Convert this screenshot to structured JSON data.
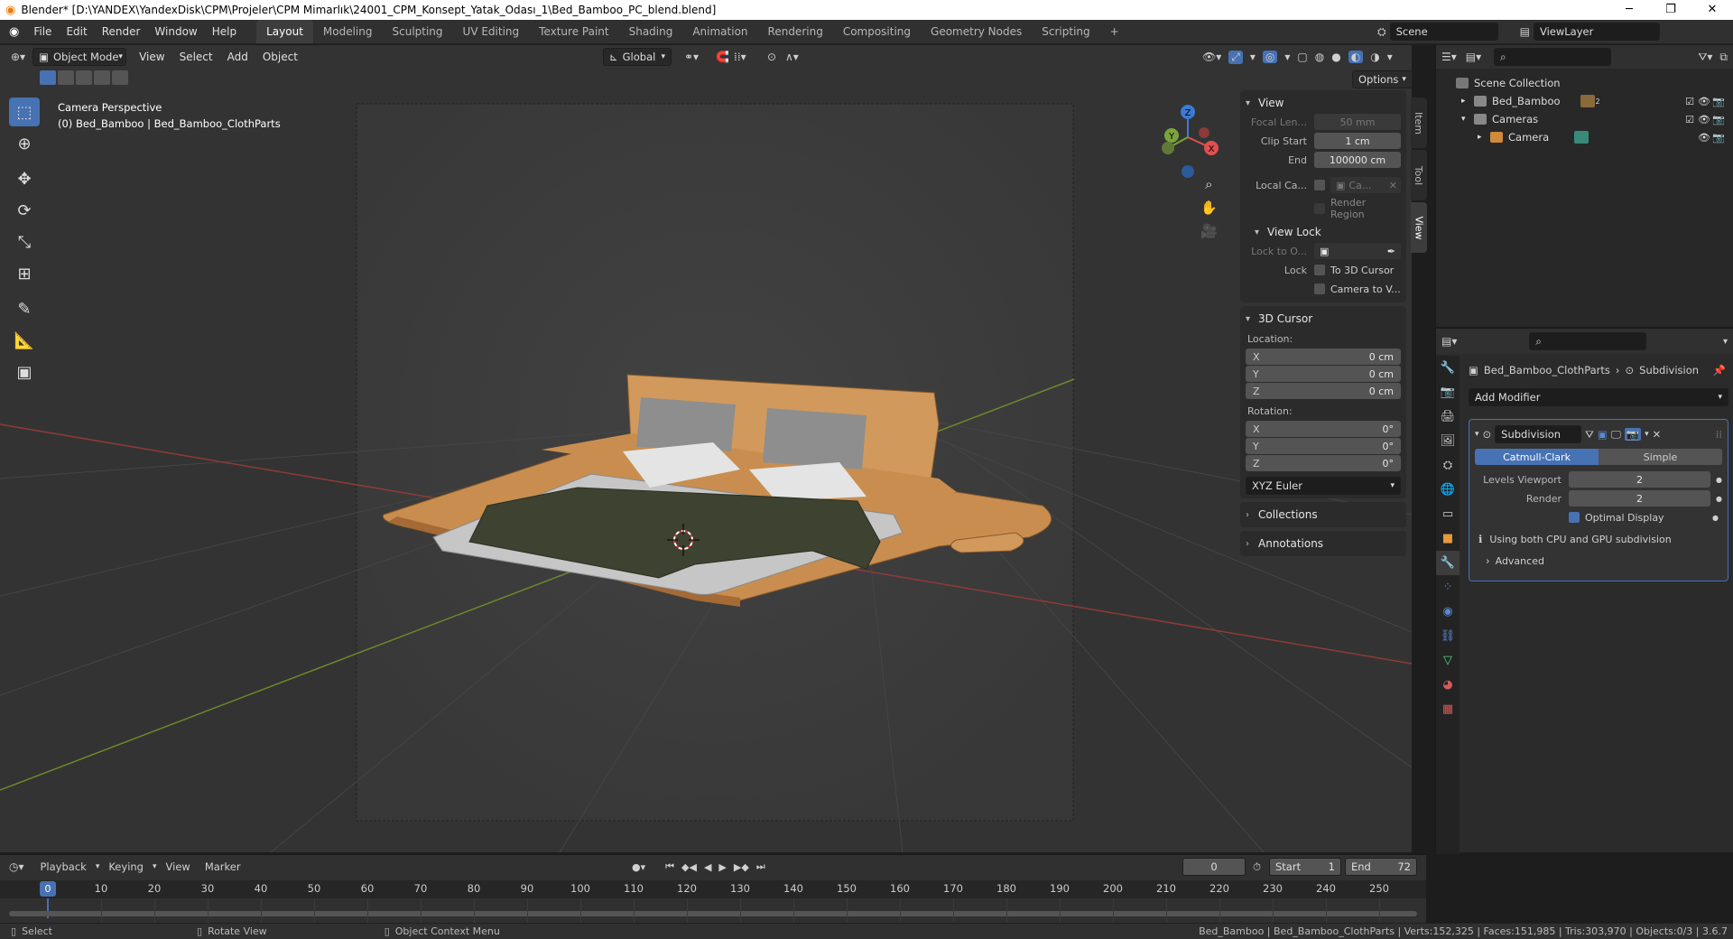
{
  "window": {
    "title": "Blender* [D:\\YANDEX\\YandexDisk\\CPM\\Projeler\\CPM Mimarlık\\24001_CPM_Konsept_Yatak_Odası_1\\Bed_Bamboo_PC_blend.blend]"
  },
  "menu": [
    "File",
    "Edit",
    "Render",
    "Window",
    "Help"
  ],
  "workspaces": [
    "Layout",
    "Modeling",
    "Sculpting",
    "UV Editing",
    "Texture Paint",
    "Shading",
    "Animation",
    "Rendering",
    "Compositing",
    "Geometry Nodes",
    "Scripting"
  ],
  "workspace_add": "+",
  "scene": {
    "name": "Scene",
    "view_layer": "ViewLayer"
  },
  "viewport": {
    "mode": "Object Mode",
    "menus": [
      "View",
      "Select",
      "Add",
      "Object"
    ],
    "orientation": "Global",
    "options": "Options",
    "overlay_title": "Camera Perspective",
    "overlay_subtitle": "(0) Bed_Bamboo | Bed_Bamboo_ClothParts"
  },
  "gizmo": {
    "z": "Z",
    "x": "X",
    "y": "Y"
  },
  "npanel": {
    "tabs": [
      "Item",
      "Tool",
      "View"
    ],
    "view": {
      "header": "View",
      "focal_label": "Focal Len...",
      "focal_value": "50 mm",
      "clip_start_label": "Clip Start",
      "clip_start_value": "1 cm",
      "end_label": "End",
      "end_value": "100000 cm",
      "local_cam_label": "Local Ca...",
      "local_cam_value": "Ca...",
      "render_region": "Render Region"
    },
    "view_lock": {
      "header": "View Lock",
      "lock_to_label": "Lock to O...",
      "lock_label": "Lock",
      "to_cursor": "To 3D Cursor",
      "camera_to_view": "Camera to V..."
    },
    "cursor": {
      "header": "3D Cursor",
      "location_label": "Location:",
      "loc": [
        {
          "a": "X",
          "v": "0 cm"
        },
        {
          "a": "Y",
          "v": "0 cm"
        },
        {
          "a": "Z",
          "v": "0 cm"
        }
      ],
      "rotation_label": "Rotation:",
      "rot": [
        {
          "a": "X",
          "v": "0°"
        },
        {
          "a": "Y",
          "v": "0°"
        },
        {
          "a": "Z",
          "v": "0°"
        }
      ],
      "rot_mode": "XYZ Euler"
    },
    "collections": "Collections",
    "annotations": "Annotations"
  },
  "outliner": {
    "root": "Scene Collection",
    "items": [
      {
        "name": "Bed_Bamboo",
        "badge": "2"
      },
      {
        "name": "Cameras"
      },
      {
        "name": "Camera"
      }
    ]
  },
  "properties": {
    "breadcrumb_obj": "Bed_Bamboo_ClothParts",
    "breadcrumb_mod": "Subdivision",
    "add_modifier": "Add Modifier",
    "modifier": {
      "name": "Subdivision",
      "catmull": "Catmull-Clark",
      "simple": "Simple",
      "levels_label": "Levels Viewport",
      "levels_value": "2",
      "render_label": "Render",
      "render_value": "2",
      "optimal": "Optimal Display",
      "info": "Using both CPU and GPU subdivision",
      "advanced": "Advanced"
    }
  },
  "timeline": {
    "menus": [
      "Playback",
      "Keying",
      "View",
      "Marker"
    ],
    "current": "0",
    "start_label": "Start",
    "start": "1",
    "end_label": "End",
    "end": "72",
    "ticks": [
      "10",
      "20",
      "30",
      "40",
      "50",
      "60",
      "70",
      "80",
      "90",
      "100",
      "110",
      "120",
      "130",
      "140",
      "150",
      "160",
      "170",
      "180",
      "190",
      "200",
      "210",
      "220",
      "230",
      "240",
      "250"
    ],
    "frame_badge": "0"
  },
  "status": {
    "select": "Select",
    "rotate": "Rotate View",
    "context": "Object Context Menu",
    "stats": "Bed_Bamboo | Bed_Bamboo_ClothParts | Verts:152,325 | Faces:151,985 | Tris:303,970 | Objects:0/3 | 3.6.7"
  },
  "colors": {
    "accent": "#4772b3",
    "viewport": "#3d3d3d",
    "panel": "#2b2b2b"
  }
}
